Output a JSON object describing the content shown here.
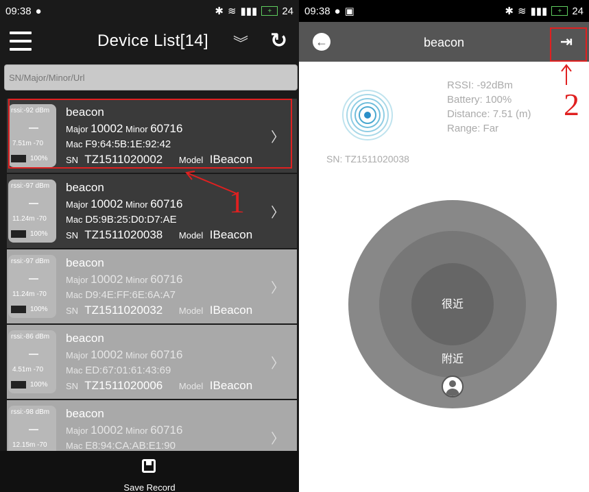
{
  "left_screen": {
    "status": {
      "time": "09:38",
      "battery": "24"
    },
    "header": {
      "title": "Device List[14]"
    },
    "search": {
      "placeholder": "SN/Major/Minor/Url"
    },
    "devices": [
      {
        "rssi": "rssi:-92 dBm",
        "dist": "7.51m -70",
        "battery": "100%",
        "name": "beacon",
        "major": "10002",
        "minor": "60716",
        "mac": "F9:64:5B:1E:92:42",
        "sn": "TZ1511020002",
        "model": "IBeacon"
      },
      {
        "rssi": "rssi:-97 dBm",
        "dist": "11.24m -70",
        "battery": "100%",
        "name": "beacon",
        "major": "10002",
        "minor": "60716",
        "mac": "D5:9B:25:D0:D7:AE",
        "sn": "TZ1511020038",
        "model": "IBeacon"
      },
      {
        "rssi": "rssi:-97 dBm",
        "dist": "11.24m -70",
        "battery": "100%",
        "name": "beacon",
        "major": "10002",
        "minor": "60716",
        "mac": "D9:4E:FF:6E:6A:A7",
        "sn": "TZ1511020032",
        "model": "IBeacon"
      },
      {
        "rssi": "rssi:-86 dBm",
        "dist": "4.51m -70",
        "battery": "100%",
        "name": "beacon",
        "major": "10002",
        "minor": "60716",
        "mac": "ED:67:01:61:43:69",
        "sn": "TZ1511020006",
        "model": "IBeacon"
      },
      {
        "rssi": "rssi:-98 dBm",
        "dist": "12.15m -70",
        "battery": "",
        "name": "beacon",
        "major": "10002",
        "minor": "60716",
        "mac": "E8:94:CA:AB:E1:90",
        "sn": "",
        "model": ""
      }
    ],
    "labels": {
      "major": "Major",
      "minor": "Minor",
      "mac": "Mac",
      "sn": "SN",
      "model": "Model"
    },
    "bottom": {
      "save_label": "Save Record"
    }
  },
  "right_screen": {
    "status": {
      "time": "09:38",
      "battery": "24"
    },
    "header": {
      "title": "beacon"
    },
    "detail": {
      "rssi": "RSSI: -92dBm",
      "battery": "Battery: 100%",
      "distance": "Distance: 7.51 (m)",
      "range": "Range: Far",
      "sn": "SN: TZ1511020038"
    },
    "radar": {
      "near": "很近",
      "nearby": "附近"
    }
  },
  "annotations": {
    "one": "1",
    "two": "2"
  },
  "colors": {
    "annotation": "#e02020",
    "dark_row": "#3a3a3a",
    "light_row": "#a9a9a9"
  }
}
